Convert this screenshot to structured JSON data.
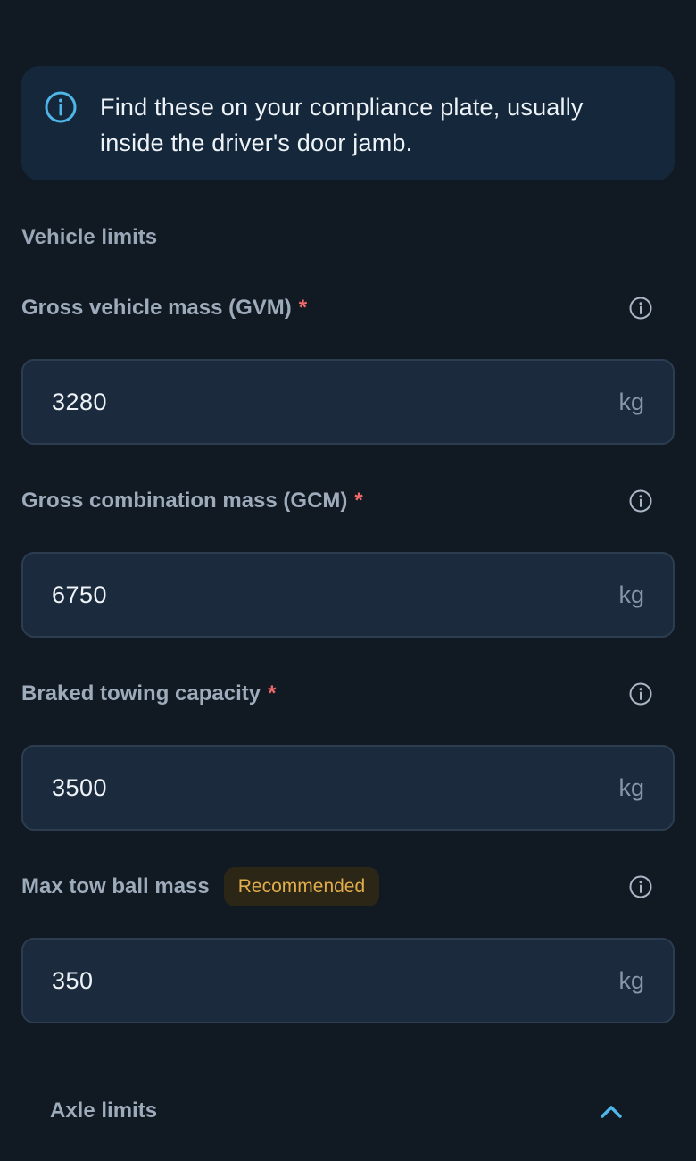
{
  "banner": {
    "icon": "info-icon",
    "text": "Find these on your compliance plate, usually inside the driver's door jamb."
  },
  "section": {
    "title": "Vehicle limits"
  },
  "fields": [
    {
      "label": "Gross vehicle mass (GVM)",
      "required_mark": "*",
      "value": "3280",
      "unit": "kg",
      "icon": "info-icon"
    },
    {
      "label": "Gross combination mass (GCM)",
      "required_mark": "*",
      "value": "6750",
      "unit": "kg",
      "icon": "info-icon"
    },
    {
      "label": "Braked towing capacity",
      "required_mark": "*",
      "value": "3500",
      "unit": "kg",
      "icon": "info-icon"
    },
    {
      "label": "Max tow ball mass",
      "badge": "Recommended",
      "value": "350",
      "unit": "kg",
      "icon": "info-icon"
    }
  ],
  "axle": {
    "label": "Axle limits",
    "icon": "chevron-up-icon",
    "expanded": true
  },
  "colors": {
    "background": "#111923",
    "banner_bg": "#15283b",
    "accent": "#4fb6e8",
    "required": "#f06a6a",
    "badge_text": "#e1ad4a"
  }
}
